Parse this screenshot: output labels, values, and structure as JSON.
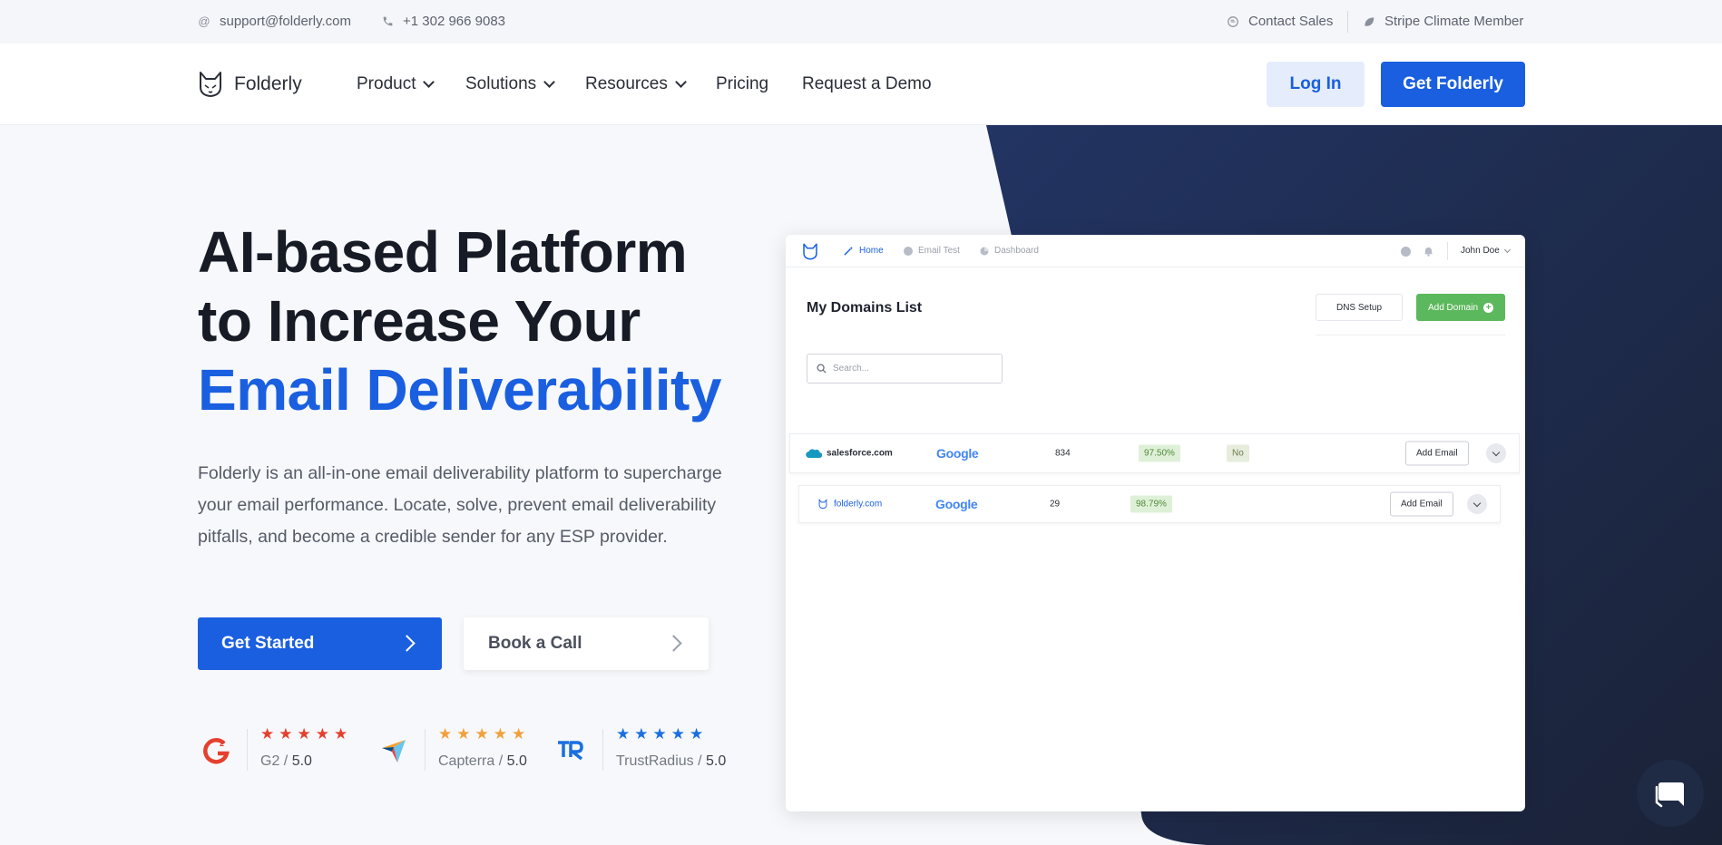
{
  "topbar": {
    "email": "support@folderly.com",
    "phone": "+1 302 966 9083",
    "contact_sales": "Contact Sales",
    "stripe": "Stripe Climate Member"
  },
  "navbar": {
    "brand": "Folderly",
    "links": [
      "Product",
      "Solutions",
      "Resources",
      "Pricing",
      "Request a Demo"
    ],
    "login": "Log In",
    "get": "Get Folderly"
  },
  "hero": {
    "title_line1": "AI-based Platform",
    "title_line2": "to Increase Your",
    "title_line3": "Email Deliverability",
    "description": "Folderly is an all-in-one email deliverability platform to supercharge your email performance. Locate, solve, prevent email deliverability pitfalls, and become a credible sender for any ESP provider.",
    "cta_primary": "Get Started",
    "cta_secondary": "Book a Call"
  },
  "ratings": [
    {
      "source": "G2",
      "score": "5.0",
      "star_color": "#e5402e",
      "stars": 5
    },
    {
      "source": "Capterra",
      "score": "5.0",
      "star_color": "#f2a03a",
      "stars": 5
    },
    {
      "source": "TrustRadius",
      "score": "5.0",
      "star_color": "#1a6fe0",
      "stars": 5
    }
  ],
  "app": {
    "tabs": [
      "Home",
      "Email Test",
      "Dashboard"
    ],
    "user": "John Doe",
    "title": "My Domains List",
    "dns_button": "DNS Setup",
    "add_button": "Add Domain",
    "search_placeholder": "Search...",
    "rows": [
      {
        "domain": "salesforce.com",
        "provider": "Google",
        "count": "834",
        "score": "97.50%",
        "status": "No",
        "action": "Add Email"
      },
      {
        "domain": "folderly.com",
        "provider": "Google",
        "count": "29",
        "score": "98.79%",
        "action": "Add Email"
      }
    ]
  },
  "colors": {
    "accent": "#1a5fe0",
    "dark_bg": "#1f2a44",
    "success": "#5cb85c"
  }
}
